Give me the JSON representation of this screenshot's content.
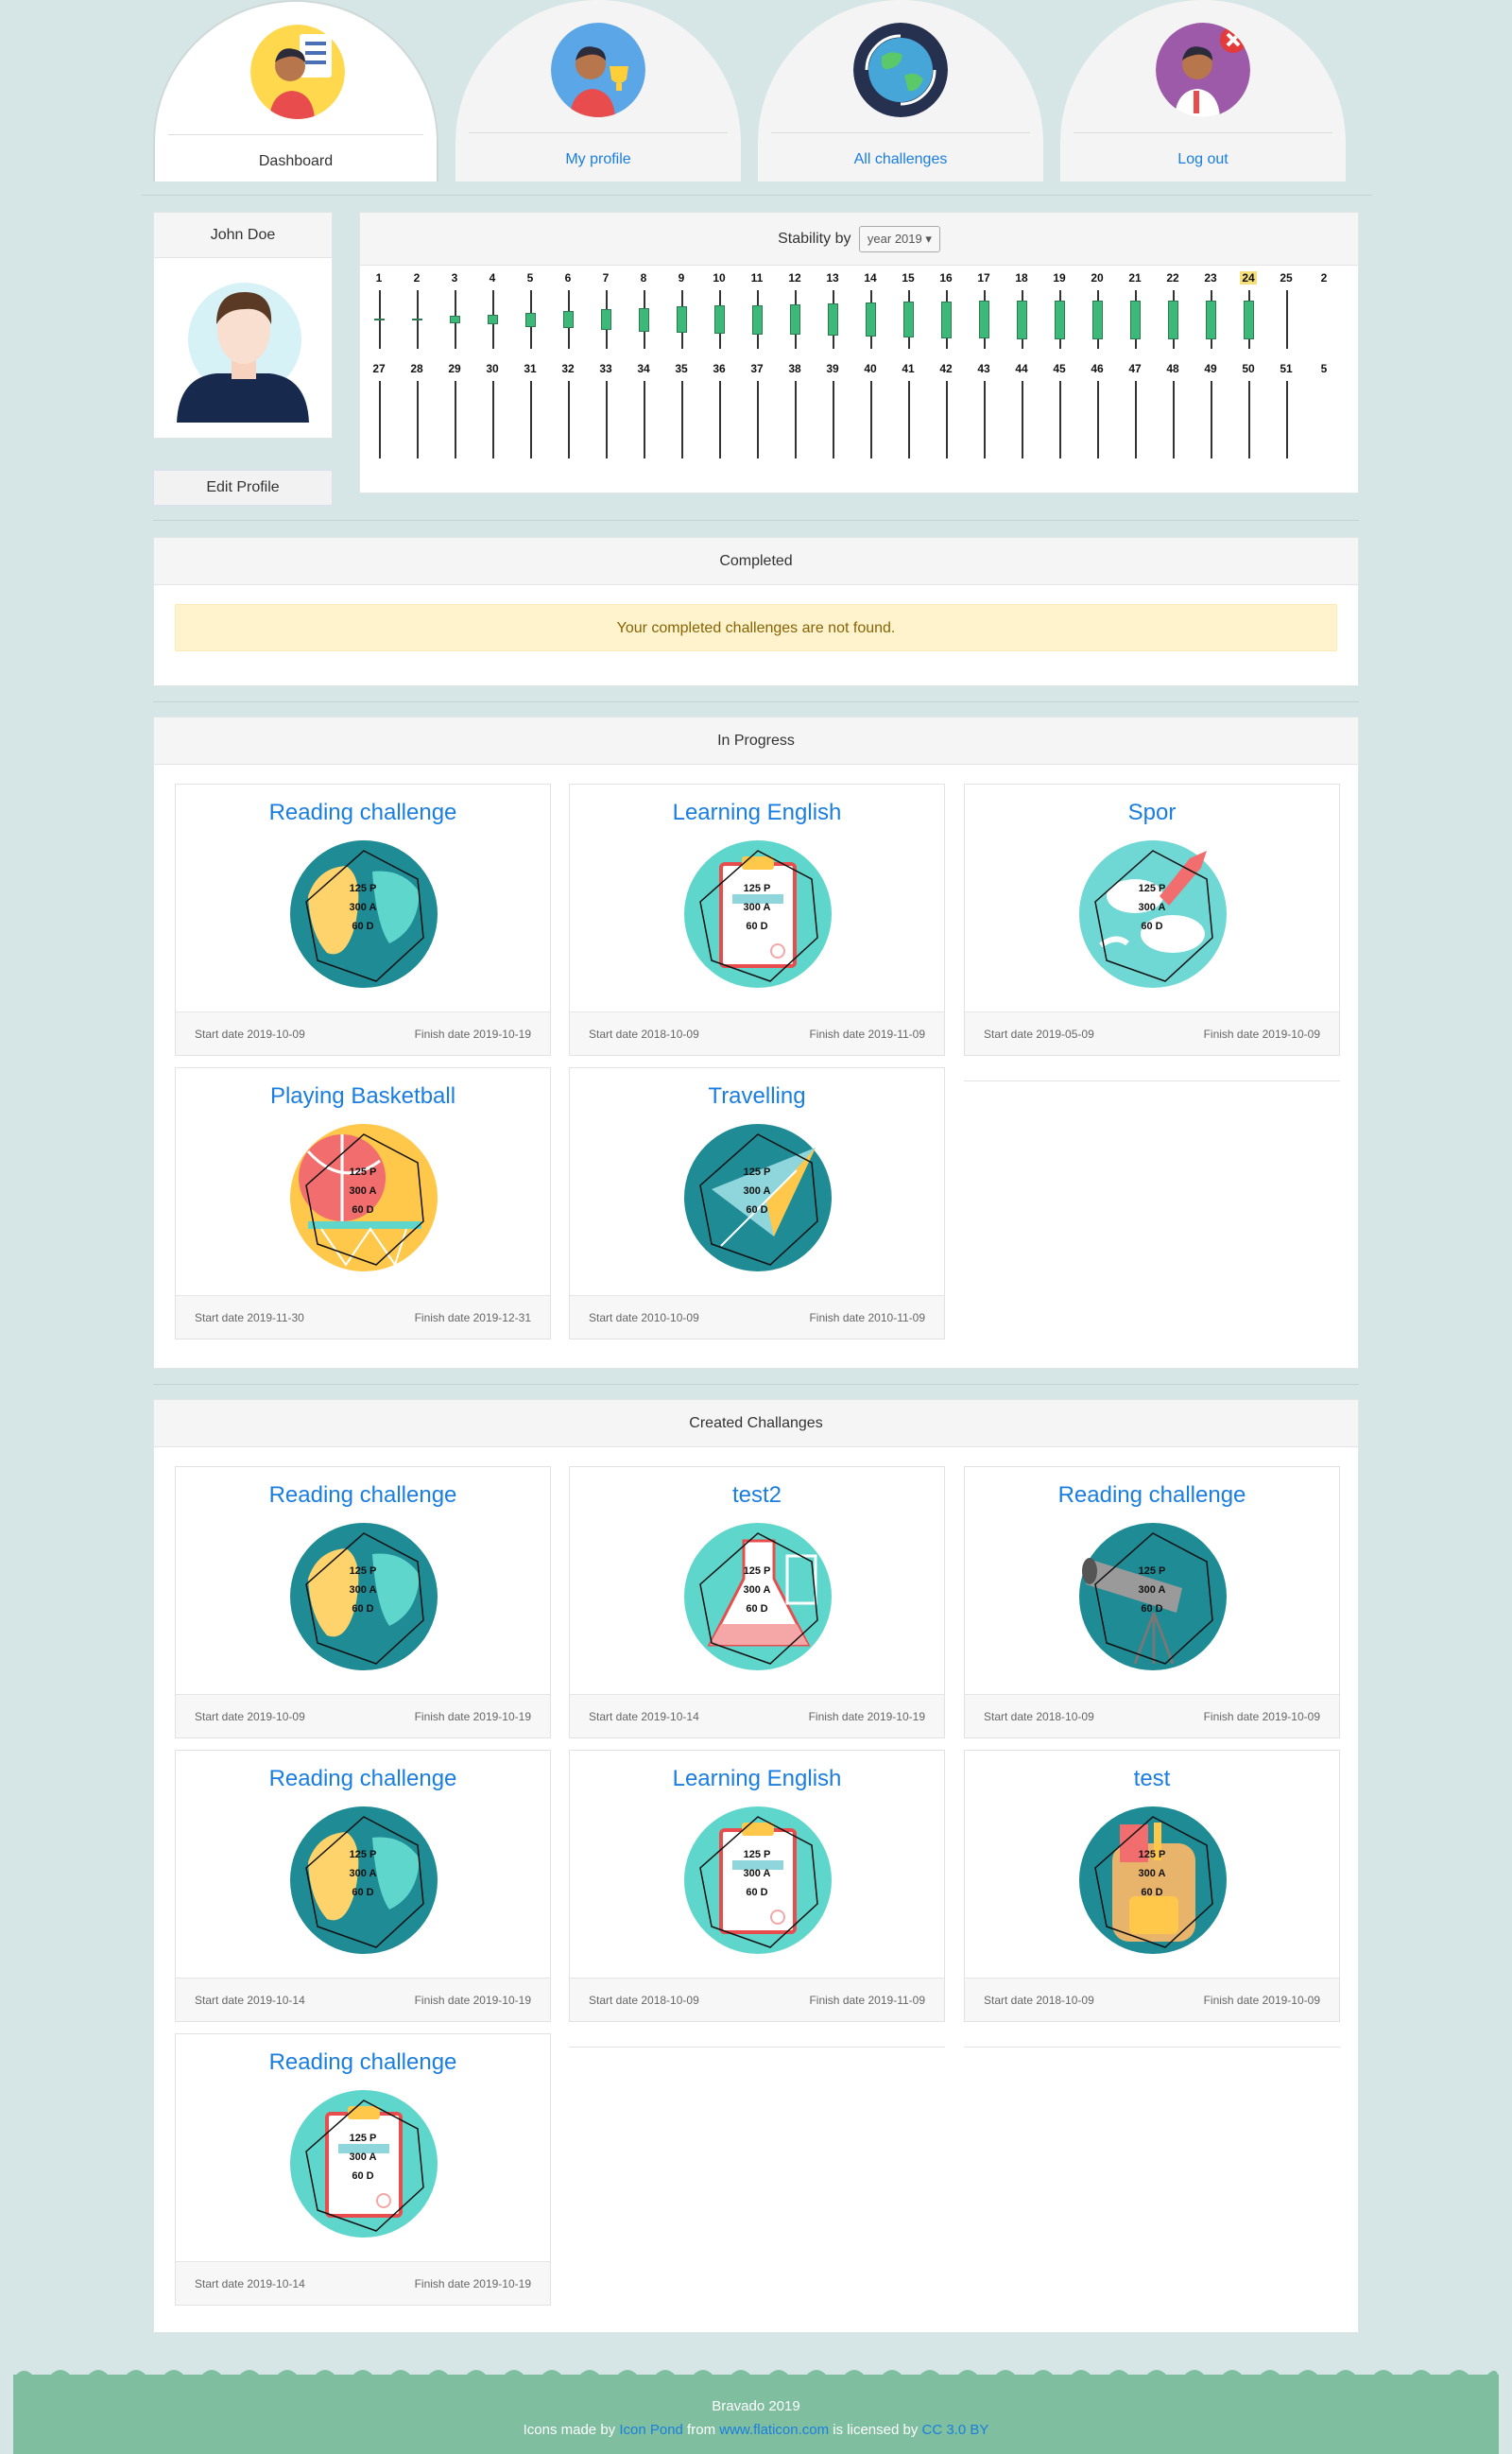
{
  "nav": {
    "items": [
      {
        "label": "Dashboard",
        "active": true
      },
      {
        "label": "My profile",
        "active": false
      },
      {
        "label": "All challenges",
        "active": false
      },
      {
        "label": "Log out",
        "active": false
      }
    ]
  },
  "profile": {
    "name": "John Doe",
    "edit_label": "Edit Profile"
  },
  "stability": {
    "label": "Stability by",
    "selected": "year 2019",
    "highlight_week": 24,
    "row1": [
      "1",
      "2",
      "3",
      "4",
      "5",
      "6",
      "7",
      "8",
      "9",
      "10",
      "11",
      "12",
      "13",
      "14",
      "15",
      "16",
      "17",
      "18",
      "19",
      "20",
      "21",
      "22",
      "23",
      "24",
      "25",
      "2"
    ],
    "row2": [
      "27",
      "28",
      "29",
      "30",
      "31",
      "32",
      "33",
      "34",
      "35",
      "36",
      "37",
      "38",
      "39",
      "40",
      "41",
      "42",
      "43",
      "44",
      "45",
      "46",
      "47",
      "48",
      "49",
      "50",
      "51",
      "5"
    ],
    "row1_progress": [
      0.02,
      0.05,
      0.15,
      0.2,
      0.3,
      0.35,
      0.45,
      0.5,
      0.55,
      0.6,
      0.62,
      0.65,
      0.68,
      0.72,
      0.75,
      0.78,
      0.8,
      0.82,
      0.82,
      0.82,
      0.82,
      0.82,
      0.82,
      0.82,
      0,
      0
    ]
  },
  "completed": {
    "title": "Completed",
    "message": "Your completed challenges are not found."
  },
  "in_progress": {
    "title": "In Progress",
    "items": [
      {
        "title": "Reading challenge",
        "p": "125 P",
        "a": "300 A",
        "d": "60 D",
        "start": "Start date 2019-10-09",
        "finish": "Finish date 2019-10-19",
        "icon": "theater-masks-icon",
        "bg": "#1e8b95",
        "fg": "#ffd36b"
      },
      {
        "title": "Learning English",
        "p": "125 P",
        "a": "300 A",
        "d": "60 D",
        "start": "Start date 2018-10-09",
        "finish": "Finish date 2019-11-09",
        "icon": "clipboard-icon",
        "bg": "#5fd6cc",
        "fg": "#f5a7a7"
      },
      {
        "title": "Spor",
        "p": "125 P",
        "a": "300 A",
        "d": "60 D",
        "start": "Start date 2019-05-09",
        "finish": "Finish date 2019-10-09",
        "icon": "rocket-icon",
        "bg": "#6fd7d4",
        "fg": "#ffffff"
      },
      {
        "title": "Playing Basketball",
        "p": "125 P",
        "a": "300 A",
        "d": "60 D",
        "start": "Start date 2019-11-30",
        "finish": "Finish date 2019-12-31",
        "icon": "basketball-icon",
        "bg": "#ffc84a",
        "fg": "#f26d6d"
      },
      {
        "title": "Travelling",
        "p": "125 P",
        "a": "300 A",
        "d": "60 D",
        "start": "Start date 2010-10-09",
        "finish": "Finish date 2010-11-09",
        "icon": "paper-plane-icon",
        "bg": "#1e8b95",
        "fg": "#8fd6dc"
      }
    ]
  },
  "created": {
    "title": "Created Challanges",
    "items": [
      {
        "title": "Reading challenge",
        "p": "125 P",
        "a": "300 A",
        "d": "60 D",
        "start": "Start date 2019-10-09",
        "finish": "Finish date 2019-10-19",
        "icon": "theater-masks-icon",
        "bg": "#1e8b95",
        "fg": "#ffd36b"
      },
      {
        "title": "test2",
        "p": "125 P",
        "a": "300 A",
        "d": "60 D",
        "start": "Start date 2019-10-14",
        "finish": "Finish date 2019-10-19",
        "icon": "flask-icon",
        "bg": "#5fd6cc",
        "fg": "#f5a7a7"
      },
      {
        "title": "Reading challenge",
        "p": "125 P",
        "a": "300 A",
        "d": "60 D",
        "start": "Start date 2018-10-09",
        "finish": "Finish date 2019-10-09",
        "icon": "telescope-icon",
        "bg": "#1e8b95",
        "fg": "#9fc9cf"
      },
      {
        "title": "Reading challenge",
        "p": "125 P",
        "a": "300 A",
        "d": "60 D",
        "start": "Start date 2019-10-14",
        "finish": "Finish date 2019-10-19",
        "icon": "theater-masks-icon",
        "bg": "#1e8b95",
        "fg": "#ffd36b"
      },
      {
        "title": "Learning English",
        "p": "125 P",
        "a": "300 A",
        "d": "60 D",
        "start": "Start date 2018-10-09",
        "finish": "Finish date 2019-11-09",
        "icon": "clipboard-icon",
        "bg": "#5fd6cc",
        "fg": "#f5a7a7"
      },
      {
        "title": "test",
        "p": "125 P",
        "a": "300 A",
        "d": "60 D",
        "start": "Start date 2018-10-09",
        "finish": "Finish date 2019-10-09",
        "icon": "backpack-icon",
        "bg": "#1e8b95",
        "fg": "#e8b36a"
      },
      {
        "title": "Reading challenge",
        "p": "125 P",
        "a": "300 A",
        "d": "60 D",
        "start": "Start date 2019-10-14",
        "finish": "Finish date 2019-10-19",
        "icon": "clipboard-icon",
        "bg": "#5fd6cc",
        "fg": "#ffffff"
      }
    ]
  },
  "footer": {
    "line1": "Bravado 2019",
    "t1": "Icons made by ",
    "l1": "Icon Pond",
    "t2": " from ",
    "l2": "www.flaticon.com",
    "t3": " is licensed by ",
    "l3": "CC 3.0 BY"
  },
  "colors": {
    "accent": "#1a7ee0",
    "candle": "#3cb878",
    "footer": "#7fbf9f"
  }
}
